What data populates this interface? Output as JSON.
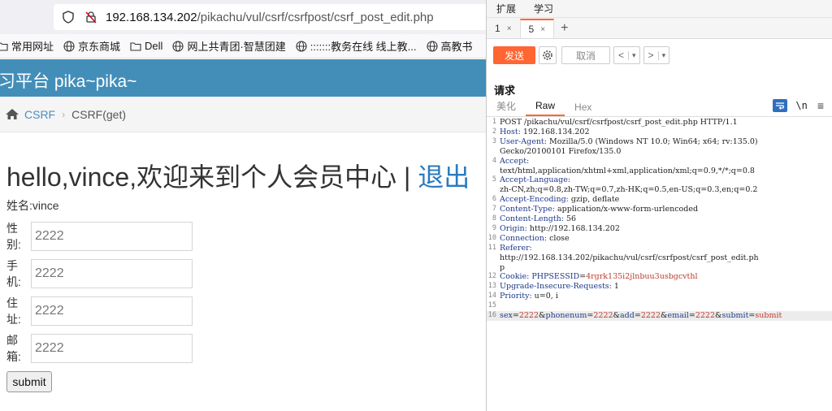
{
  "browser": {
    "url_host": "192.168.134.202",
    "url_path": "/pikachu/vul/csrf/csrfpost/csrf_post_edit.php",
    "bookmarks": [
      "常用网址",
      "京东商城",
      "Dell",
      "网上共青团·智慧团建",
      ":::::::教务在线 线上教...",
      "高教书"
    ],
    "site_title": "习平台 pika~pika~",
    "breadcrumb": {
      "section": "CSRF",
      "current": "CSRF(get)"
    },
    "welcome": "hello,vince,欢迎来到个人会员中心 | ",
    "logout": "退出",
    "name_line": "姓名:vince",
    "fields": [
      {
        "label": "性别:",
        "value": "2222"
      },
      {
        "label": "手机:",
        "value": "2222"
      },
      {
        "label": "住址:",
        "value": "2222"
      },
      {
        "label": "邮箱:",
        "value": "2222"
      }
    ],
    "submit_label": "submit"
  },
  "burp": {
    "menu": [
      "扩展",
      "学习"
    ],
    "tabs": [
      {
        "label": "1",
        "close": "×"
      },
      {
        "label": "5",
        "close": "×"
      }
    ],
    "add_tab": "+",
    "send_label": "发送",
    "cancel_label": "取消",
    "back_glyph": "<",
    "forward_glyph": ">",
    "caret_glyph": "▾",
    "request_title": "请求",
    "view_tabs": [
      "美化",
      "Raw",
      "Hex"
    ],
    "newline_label": "\\n",
    "menu_glyph": "≡",
    "colors": {
      "accent": "#ff6633",
      "header_name": "#1d3a8a",
      "value_red": "#c0392b"
    },
    "lines": [
      {
        "n": "1",
        "text": "POST /pikachu/vul/csrf/csrfpost/csrf_post_edit.php HTTP/1.1"
      },
      {
        "n": "2",
        "name": "Host",
        "value": " 192.168.134.202"
      },
      {
        "n": "3",
        "name": "User-Agent",
        "value": " Mozilla/5.0 (Windows NT 10.0; Win64; x64; rv:135.0)"
      },
      {
        "n": "",
        "text": "Gecko/20100101 Firefox/135.0"
      },
      {
        "n": "4",
        "name": "Accept",
        "value": ""
      },
      {
        "n": "",
        "text": "text/html,application/xhtml+xml,application/xml;q=0.9,*/*;q=0.8"
      },
      {
        "n": "5",
        "name": "Accept-Language",
        "value": ""
      },
      {
        "n": "",
        "text": "zh-CN,zh;q=0.8,zh-TW;q=0.7,zh-HK;q=0.5,en-US;q=0.3,en;q=0.2"
      },
      {
        "n": "6",
        "name": "Accept-Encoding",
        "value": " gzip, deflate"
      },
      {
        "n": "7",
        "name": "Content-Type",
        "value": " application/x-www-form-urlencoded"
      },
      {
        "n": "8",
        "name": "Content-Length",
        "value": " 56"
      },
      {
        "n": "9",
        "name": "Origin",
        "value": " http://192.168.134.202"
      },
      {
        "n": "10",
        "name": "Connection",
        "value": " close"
      },
      {
        "n": "11",
        "name": "Referer",
        "value": ""
      },
      {
        "n": "",
        "text": "http://192.168.134.202/pikachu/vul/csrf/csrfpost/csrf_post_edit.ph"
      },
      {
        "n": "",
        "text": "p"
      },
      {
        "n": "12",
        "name": "Cookie",
        "value": " ",
        "cookie_name": "PHPSESSID",
        "cookie_value": "4rgrk135i2jlnbuu3usbgcvthl"
      },
      {
        "n": "13",
        "name": "Upgrade-Insecure-Requests",
        "value": " 1"
      },
      {
        "n": "14",
        "name": "Priority",
        "value": " u=0, i"
      },
      {
        "n": "15",
        "text": ""
      },
      {
        "n": "16",
        "body": [
          {
            "k": "sex",
            "v": "2222"
          },
          {
            "k": "phonenum",
            "v": "2222"
          },
          {
            "k": "add",
            "v": "2222"
          },
          {
            "k": "email",
            "v": "2222"
          },
          {
            "k": "submit",
            "v": "submit"
          }
        ]
      }
    ]
  }
}
